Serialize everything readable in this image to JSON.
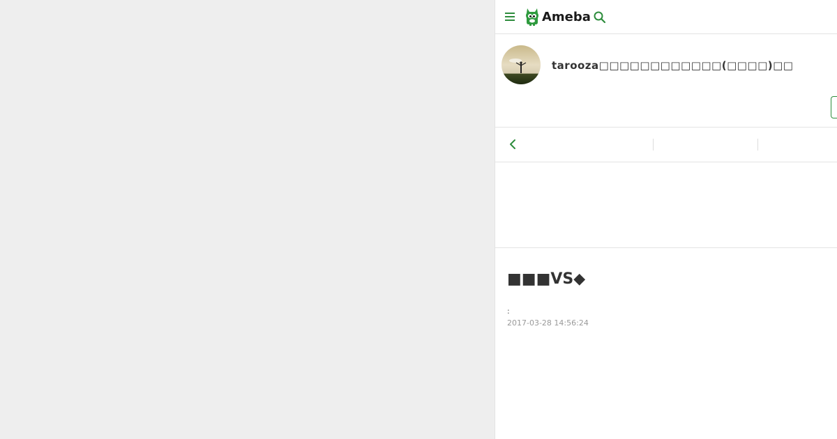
{
  "header": {
    "logo_text": "Ameba",
    "menu_icon": "hamburger-menu-icon",
    "search_icon": "search-icon",
    "logo_icon": "ameba-mascot-icon"
  },
  "profile": {
    "blog_title": "tarooza□□□□□□□□□□□□(□□□□)□□",
    "avatar_icon": "avatar-image"
  },
  "nav": {
    "back_icon": "chevron-left-icon"
  },
  "article": {
    "title": "■■■VS◆",
    "meta_label": ":",
    "date": "2017-03-28 14:56:24"
  },
  "colors": {
    "accent": "#2d8c3c",
    "background": "#eeeeee",
    "panel": "#ffffff"
  }
}
